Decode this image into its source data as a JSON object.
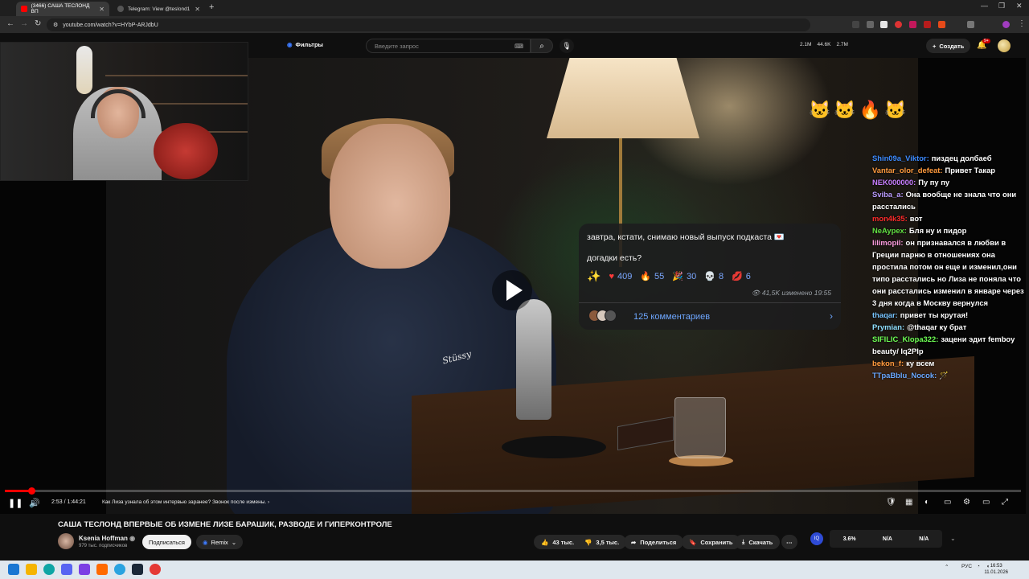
{
  "browser": {
    "tabs": [
      {
        "label": "(3466) САША ТЕСЛОНД ВП"
      },
      {
        "label": "Telegram: View @teslond1"
      }
    ],
    "url": "youtube.com/watch?v=HYbP-ARJdbU"
  },
  "masthead": {
    "filters_label": "Фильтры",
    "search_placeholder": "Введите запрос",
    "stats": [
      "2.1M",
      "44.6K",
      "2.7M"
    ],
    "create_label": "Создать",
    "bell_badge": "9+"
  },
  "telegram_post": {
    "line1": "завтра, кстати, снимаю новый выпуск подкаста",
    "line2": "догадки есть?",
    "reactions": [
      {
        "icon": "heart",
        "count": "409"
      },
      {
        "icon": "fire",
        "count": "55"
      },
      {
        "icon": "party",
        "count": "30"
      },
      {
        "icon": "skull",
        "count": "8"
      },
      {
        "icon": "lips",
        "count": "6"
      }
    ],
    "views_edited": "41,5K изменено 19:55",
    "comments": "125 комментариев"
  },
  "chat": [
    {
      "user": "Shin09a_Viktor",
      "color": "#3d8bff",
      "text": "пиздец долбаеб"
    },
    {
      "user": "Vantar_olor_defeat",
      "color": "#ff9a3d",
      "text": "Привет Такар"
    },
    {
      "user": "NEK000000",
      "color": "#c77dff",
      "text": "Пу пу пу"
    },
    {
      "user": "Sviba_a",
      "color": "#b99bff",
      "text": "Она вообще не знала что они расстались"
    },
    {
      "user": "mon4k35",
      "color": "#ff2a2a",
      "text": "вот"
    },
    {
      "user": "NeAypex",
      "color": "#62e043",
      "text": "Бля ну и пидор"
    },
    {
      "user": "lilimopil",
      "color": "#ff9de0",
      "text": "он признавался в любви в Греции парню в отношениях она простила потом он еще и изменил,они типо расстались но Лиза не поняла что они расстались изменил в январе через 3 дня когда в Москву вернулся"
    },
    {
      "user": "thaqar",
      "color": "#77c4ff",
      "text": "привет ты крутая!"
    },
    {
      "user": "Prymian",
      "color": "#8fe0ff",
      "text": "@thaqar ку брат"
    },
    {
      "user": "SIFILIC_Klopa322",
      "color": "#6dff54",
      "text": "зацени эдит femboy beauty/ Iq2PIp"
    },
    {
      "user": "bekon_f",
      "color": "#ff9a3d",
      "text": "ку всем"
    },
    {
      "user": "TTpaBblu_Nocok",
      "color": "#6aa8ff",
      "text": "🪄"
    }
  ],
  "player": {
    "progress": 0.0265,
    "time": "2:53 / 1:44:21",
    "chapter": "Как Лиза узнала об этом интервью заранее? Звонок после измены."
  },
  "video_info": {
    "title": "САША ТЕСЛОНД ВПЕРВЫЕ ОБ ИЗМЕНЕ ЛИЗЕ БАРАШИК, РАЗВОДЕ И ГИПЕРКОНТРОЛЕ",
    "channel": "Ksenia Hoffman",
    "subscribers": "979 тыс. подписчиков",
    "subscribe_label": "Подписаться",
    "remix_label": "Remix",
    "likes": "43 тыс.",
    "dislikes": "3,5 тыс.",
    "share_label": "Поделиться",
    "save_label": "Сохранить",
    "download_label": "Скачать",
    "rating": [
      "3.6%",
      "N/A",
      "N/A"
    ]
  },
  "taskbar": {
    "lang": "РУС",
    "time": "16:53",
    "date": "11.01.2026"
  }
}
